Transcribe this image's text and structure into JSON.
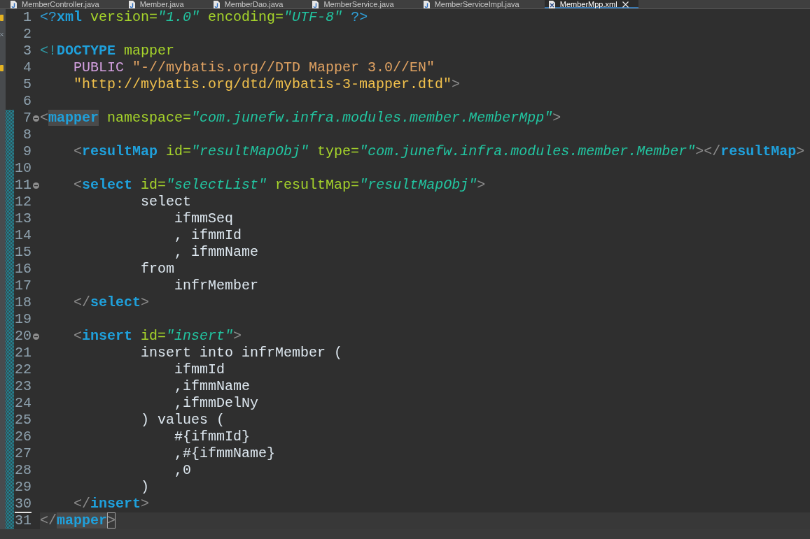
{
  "tabs": [
    {
      "label": "MemberController.java",
      "kind": "java",
      "selected": false
    },
    {
      "label": "Member.java",
      "kind": "java",
      "selected": false
    },
    {
      "label": "MemberDao.java",
      "kind": "java",
      "selected": false
    },
    {
      "label": "MemberService.java",
      "kind": "java",
      "selected": false
    },
    {
      "label": "MemberServiceImpl.java",
      "kind": "java",
      "selected": false
    },
    {
      "label": "MemberMpp.xml",
      "kind": "xml",
      "selected": true
    }
  ],
  "editor": {
    "lines": [
      {
        "number": "1",
        "changed": false,
        "current": false,
        "number_underlined": false,
        "annotation": {
          "kind": "warning"
        },
        "tokens": [
          {
            "kind": "pi",
            "text": "<?"
          },
          {
            "kind": "tag",
            "text": "xml"
          },
          {
            "kind": "attr",
            "text": " version="
          },
          {
            "kind": "value",
            "text": "\"1.0\""
          },
          {
            "kind": "attr",
            "text": " encoding="
          },
          {
            "kind": "value",
            "text": "\"UTF-8\""
          },
          {
            "kind": "pi",
            "text": " ?>"
          }
        ]
      },
      {
        "number": "2",
        "changed": false,
        "current": false,
        "number_underlined": false,
        "annotation": {
          "kind": "info"
        }
      },
      {
        "number": "3",
        "changed": false,
        "current": false,
        "number_underlined": false,
        "tokens": [
          {
            "kind": "doctype",
            "text": "<!"
          },
          {
            "kind": "tag",
            "text": "DOCTYPE"
          },
          {
            "kind": "attr",
            "text": " mapper"
          }
        ]
      },
      {
        "number": "4",
        "changed": false,
        "current": false,
        "number_underlined": false,
        "annotation": {
          "kind": "warning"
        },
        "tokens": [
          {
            "kind": "keyword",
            "text": "    PUBLIC"
          },
          {
            "kind": "string",
            "text": " \"-//mybatis.org//DTD Mapper 3.0//EN\""
          }
        ]
      },
      {
        "number": "5",
        "changed": false,
        "current": false,
        "number_underlined": false,
        "tokens": [
          {
            "kind": "uri",
            "text": "    \"http://mybatis.org/dtd/mybatis-3-mapper.dtd\""
          },
          {
            "kind": "delim",
            "text": ">"
          }
        ]
      },
      {
        "number": "6",
        "changed": false,
        "current": false,
        "number_underlined": false
      },
      {
        "number": "7",
        "changed": true,
        "current": false,
        "number_underlined": false,
        "expanded": true,
        "tokens": [
          {
            "kind": "delim",
            "text": "<"
          },
          {
            "kind": "tag",
            "text": "mapper",
            "highlighted": true
          },
          {
            "kind": "attr",
            "text": " namespace="
          },
          {
            "kind": "value",
            "text": "\"com.junefw.infra.modules.member.MemberMpp\""
          },
          {
            "kind": "delim",
            "text": ">"
          }
        ]
      },
      {
        "number": "8",
        "changed": true,
        "current": false,
        "number_underlined": false
      },
      {
        "number": "9",
        "changed": true,
        "current": false,
        "number_underlined": false,
        "tokens": [
          {
            "kind": "delim",
            "text": "    <"
          },
          {
            "kind": "tag",
            "text": "resultMap"
          },
          {
            "kind": "attr",
            "text": " id="
          },
          {
            "kind": "value",
            "text": "\"resultMapObj\""
          },
          {
            "kind": "attr",
            "text": " type="
          },
          {
            "kind": "value",
            "text": "\"com.junefw.infra.modules.member.Member\""
          },
          {
            "kind": "delim",
            "text": "></"
          },
          {
            "kind": "tag",
            "text": "resultMap"
          },
          {
            "kind": "delim",
            "text": ">"
          }
        ]
      },
      {
        "number": "10",
        "changed": true,
        "current": false,
        "number_underlined": false
      },
      {
        "number": "11",
        "changed": true,
        "current": false,
        "number_underlined": false,
        "expanded": true,
        "tokens": [
          {
            "kind": "delim",
            "text": "    <"
          },
          {
            "kind": "tag",
            "text": "select"
          },
          {
            "kind": "attr",
            "text": " id="
          },
          {
            "kind": "value",
            "text": "\"selectList\""
          },
          {
            "kind": "attr",
            "text": " resultMap="
          },
          {
            "kind": "value",
            "text": "\"resultMapObj\""
          },
          {
            "kind": "delim",
            "text": ">"
          }
        ]
      },
      {
        "number": "12",
        "changed": true,
        "current": false,
        "number_underlined": false,
        "tokens": [
          {
            "kind": "text",
            "text": "            select"
          }
        ]
      },
      {
        "number": "13",
        "changed": true,
        "current": false,
        "number_underlined": false,
        "tokens": [
          {
            "kind": "text",
            "text": "                ifmmSeq"
          }
        ]
      },
      {
        "number": "14",
        "changed": true,
        "current": false,
        "number_underlined": false,
        "tokens": [
          {
            "kind": "text",
            "text": "                , ifmmId"
          }
        ]
      },
      {
        "number": "15",
        "changed": true,
        "current": false,
        "number_underlined": false,
        "tokens": [
          {
            "kind": "text",
            "text": "                , ifmmName"
          }
        ]
      },
      {
        "number": "16",
        "changed": true,
        "current": false,
        "number_underlined": false,
        "tokens": [
          {
            "kind": "text",
            "text": "            from"
          }
        ]
      },
      {
        "number": "17",
        "changed": true,
        "current": false,
        "number_underlined": false,
        "tokens": [
          {
            "kind": "text",
            "text": "                infrMember"
          }
        ]
      },
      {
        "number": "18",
        "changed": true,
        "current": false,
        "number_underlined": false,
        "tokens": [
          {
            "kind": "delim",
            "text": "    </"
          },
          {
            "kind": "tag",
            "text": "select"
          },
          {
            "kind": "delim",
            "text": ">"
          }
        ]
      },
      {
        "number": "19",
        "changed": true,
        "current": false,
        "number_underlined": false
      },
      {
        "number": "20",
        "changed": true,
        "current": false,
        "number_underlined": false,
        "expanded": true,
        "tokens": [
          {
            "kind": "delim",
            "text": "    <"
          },
          {
            "kind": "tag",
            "text": "insert"
          },
          {
            "kind": "attr",
            "text": " id="
          },
          {
            "kind": "value",
            "text": "\"insert\""
          },
          {
            "kind": "delim",
            "text": ">"
          }
        ]
      },
      {
        "number": "21",
        "changed": true,
        "current": false,
        "number_underlined": false,
        "tokens": [
          {
            "kind": "text",
            "text": "            insert into infrMember ("
          }
        ]
      },
      {
        "number": "22",
        "changed": true,
        "current": false,
        "number_underlined": false,
        "tokens": [
          {
            "kind": "text",
            "text": "                ifmmId"
          }
        ]
      },
      {
        "number": "23",
        "changed": true,
        "current": false,
        "number_underlined": false,
        "tokens": [
          {
            "kind": "text",
            "text": "                ,ifmmName"
          }
        ]
      },
      {
        "number": "24",
        "changed": true,
        "current": false,
        "number_underlined": false,
        "tokens": [
          {
            "kind": "text",
            "text": "                ,ifmmDelNy"
          }
        ]
      },
      {
        "number": "25",
        "changed": true,
        "current": false,
        "number_underlined": false,
        "tokens": [
          {
            "kind": "text",
            "text": "            ) values ("
          }
        ]
      },
      {
        "number": "26",
        "changed": true,
        "current": false,
        "number_underlined": false,
        "tokens": [
          {
            "kind": "text",
            "text": "                #{ifmmId}"
          }
        ]
      },
      {
        "number": "27",
        "changed": true,
        "current": false,
        "number_underlined": false,
        "tokens": [
          {
            "kind": "text",
            "text": "                ,#{ifmmName}"
          }
        ]
      },
      {
        "number": "28",
        "changed": true,
        "current": false,
        "number_underlined": false,
        "tokens": [
          {
            "kind": "text",
            "text": "                ,0"
          }
        ]
      },
      {
        "number": "29",
        "changed": true,
        "current": false,
        "number_underlined": false,
        "tokens": [
          {
            "kind": "text",
            "text": "            )"
          }
        ]
      },
      {
        "number": "30",
        "changed": true,
        "current": false,
        "number_underlined": true,
        "tokens": [
          {
            "kind": "delim",
            "text": "    </"
          },
          {
            "kind": "tag",
            "text": "insert"
          },
          {
            "kind": "delim",
            "text": ">"
          }
        ]
      },
      {
        "number": "31",
        "changed": true,
        "current": true,
        "number_underlined": false,
        "tokens": [
          {
            "kind": "delim",
            "text": "</"
          },
          {
            "kind": "tag",
            "text": "mapper",
            "highlighted": true
          },
          {
            "kind": "delim",
            "text": ">",
            "bracket_matched": true
          }
        ]
      }
    ]
  }
}
